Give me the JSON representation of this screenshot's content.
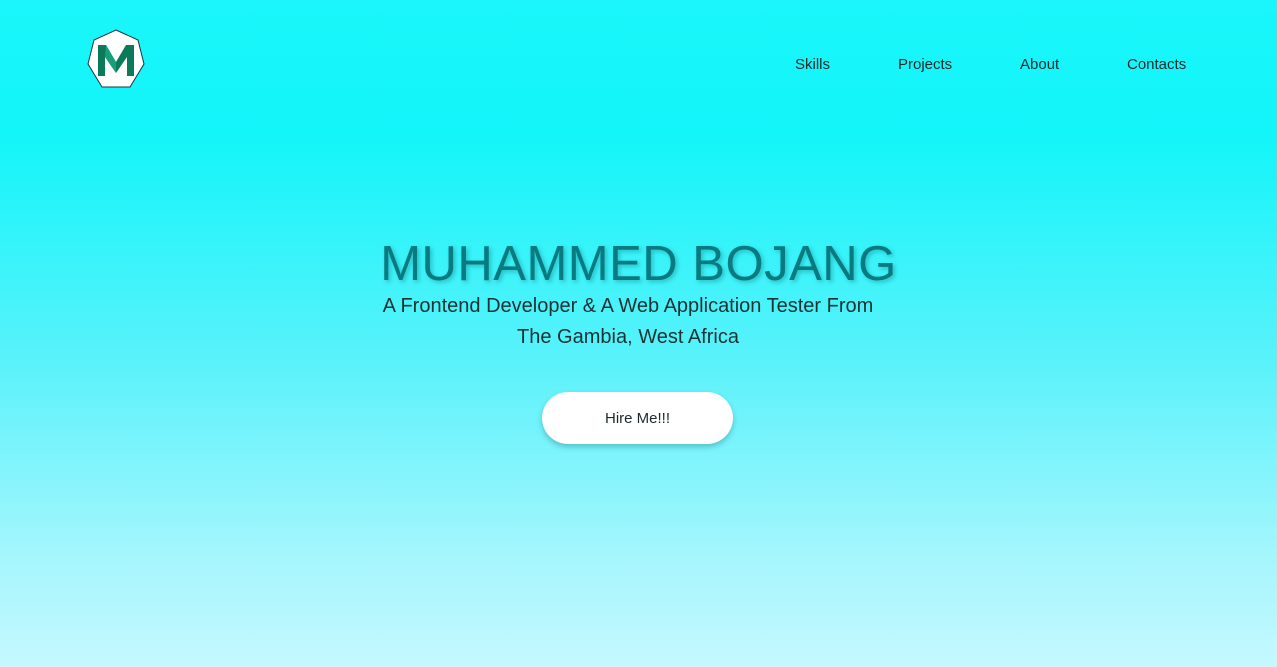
{
  "logo": {
    "letter": "M",
    "icon": "heptagon-m-logo-icon"
  },
  "nav": {
    "items": [
      {
        "label": "Skills"
      },
      {
        "label": "Projects"
      },
      {
        "label": "About"
      },
      {
        "label": "Contacts"
      }
    ]
  },
  "hero": {
    "title": "MUHAMMED BOJANG",
    "subtitle": "A Frontend Developer & A Web Application Tester From The Gambia, West Africa",
    "cta_label": "Hire Me!!!"
  },
  "colors": {
    "background_top": "#12f5f9",
    "background_bottom": "#c4f8fe",
    "title": "#087a80",
    "logo_letter": "#0b7a5a",
    "button_bg": "#ffffff"
  }
}
